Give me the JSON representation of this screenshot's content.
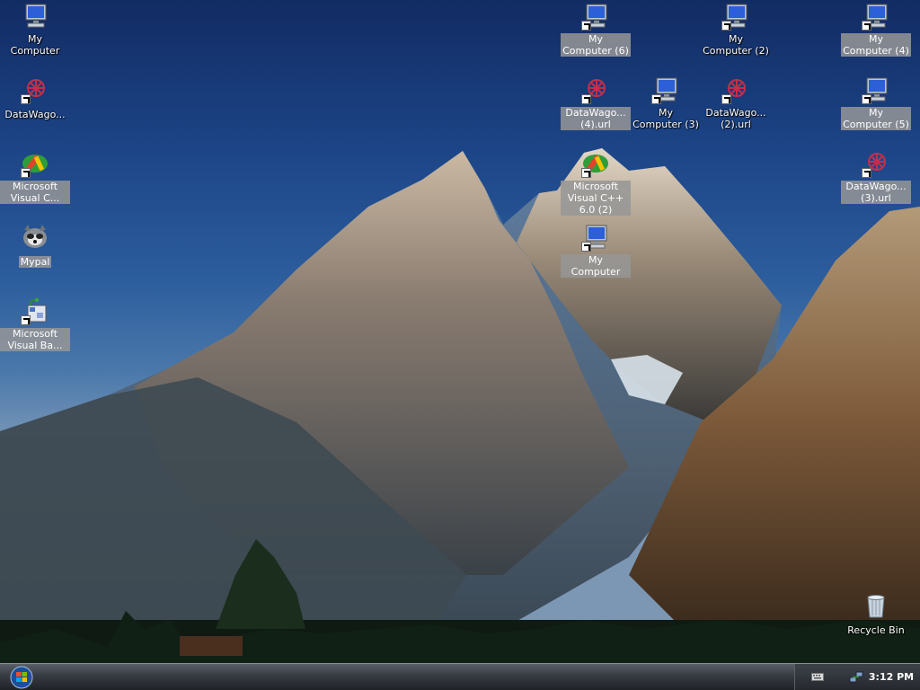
{
  "desktop_icons": [
    {
      "label": "My Computer",
      "icon": "my-computer-icon"
    },
    {
      "label": "DataWago...",
      "icon": "datawagon-icon"
    },
    {
      "label": "Microsoft Visual C...",
      "icon": "visual-cpp-icon"
    },
    {
      "label": "Mypal",
      "icon": "mypal-icon"
    },
    {
      "label": "Microsoft Visual Ba...",
      "icon": "visual-basic-icon"
    },
    {
      "label": "My Computer (6)",
      "icon": "my-computer-icon"
    },
    {
      "label": "DataWago... (4).url",
      "icon": "datawagon-icon"
    },
    {
      "label": "My Computer (3)",
      "icon": "my-computer-icon"
    },
    {
      "label": "Microsoft Visual C++ 6.0 (2)",
      "icon": "visual-cpp-icon"
    },
    {
      "label": "My Computer",
      "icon": "my-computer-icon"
    },
    {
      "label": "My Computer (2)",
      "icon": "my-computer-icon"
    },
    {
      "label": "DataWago... (2).url",
      "icon": "datawagon-icon"
    },
    {
      "label": "My Computer (4)",
      "icon": "my-computer-icon"
    },
    {
      "label": "My Computer (5)",
      "icon": "my-computer-icon"
    },
    {
      "label": "DataWago... (3).url",
      "icon": "datawagon-icon"
    },
    {
      "label": "Recycle Bin",
      "icon": "recycle-bin-icon"
    }
  ],
  "taskbar": {
    "start_icon": "windows-start-orb-icon",
    "tray_icons": [
      "keyboard-icon",
      "network-icon"
    ],
    "clock": "3:12 PM"
  },
  "colors": {
    "taskbar": "#2a2d33",
    "selection": "#969696",
    "sky": "#1c4486"
  }
}
